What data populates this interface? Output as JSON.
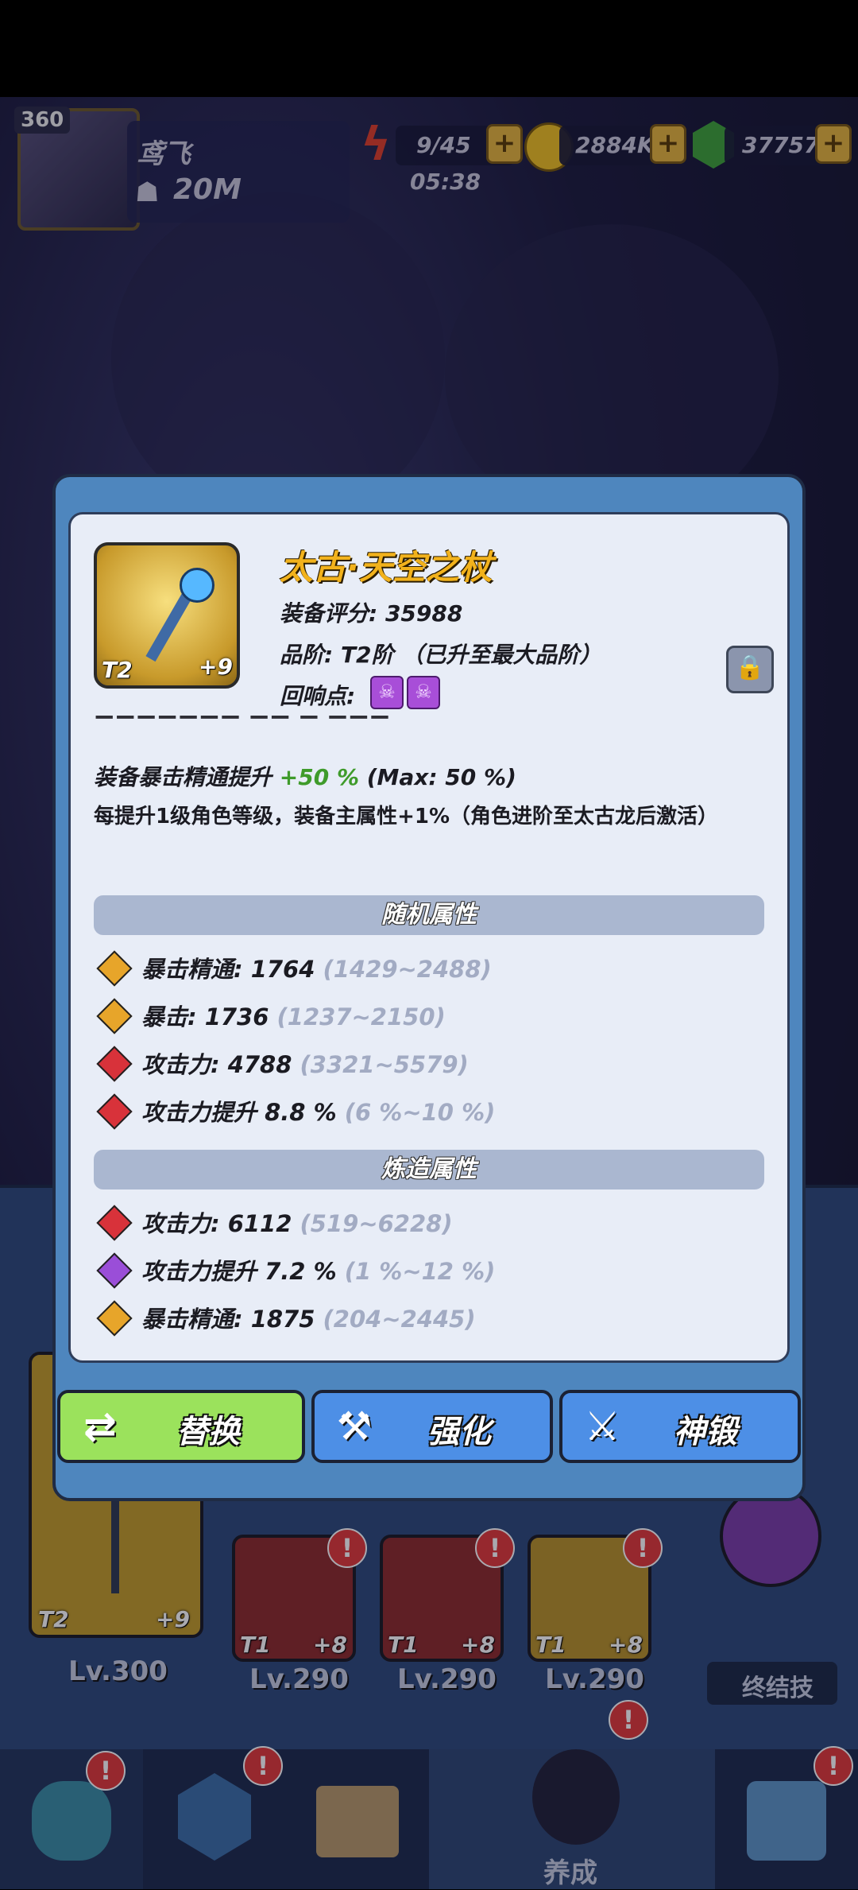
{
  "hud": {
    "level": "360",
    "player_name": "鸢飞",
    "power": "20M",
    "stamina": "9/45",
    "stamina_timer": "05:38",
    "gold": "2884K",
    "gems": "37757",
    "plus": "+"
  },
  "item": {
    "name": "太古·天空之杖",
    "tier_badge": "T2",
    "enhance": "+9",
    "score_label": "装备评分: 35988",
    "grade_label": "品阶: T2阶 （已升至最大品阶）",
    "echo_label": "回响点:",
    "echo_icons": [
      "skull-icon",
      "skull-icon"
    ]
  },
  "details": {
    "crit_mastery_boost_prefix": "装备暴击精通提升",
    "crit_mastery_boost_value": "+50 %",
    "crit_mastery_boost_max": "(Max: 50 %)",
    "level_bonus": "每提升1级角色等级，装备主属性+1%（角色进阶至太古龙后激活）"
  },
  "random_section": {
    "title": "随机属性",
    "attrs": [
      {
        "gem": "gold",
        "label": "暴击精通: 1764",
        "range": "(1429~2488)"
      },
      {
        "gem": "gold",
        "label": "暴击: 1736",
        "range": "(1237~2150)"
      },
      {
        "gem": "red",
        "label": "攻击力: 4788",
        "range": "(3321~5579)"
      },
      {
        "gem": "red",
        "label": "攻击力提升 8.8 %",
        "range": "(6 %~10 %)"
      }
    ]
  },
  "forge_section": {
    "title": "炼造属性",
    "attrs": [
      {
        "gem": "red",
        "label": "攻击力: 6112",
        "range": "(519~6228)"
      },
      {
        "gem": "purple",
        "label": "攻击力提升 7.2 %",
        "range": "(1 %~12 %)"
      },
      {
        "gem": "gold",
        "label": "暴击精通: 1875",
        "range": "(204~2445)"
      }
    ]
  },
  "buttons": {
    "replace": "替换",
    "enhance": "强化",
    "divine_forge": "神锻"
  },
  "colors": {
    "gold": "#e7a52a",
    "red": "#d8323a",
    "purple": "#9a4ed8",
    "green_btn": "#9be25c",
    "blue_btn": "#4d8fe6",
    "boost_green": "#3f9b2b"
  },
  "bottom": {
    "main_card": {
      "tier": "T2",
      "enhance": "+9",
      "level": "Lv.300"
    },
    "cards": [
      {
        "tier": "T1",
        "enhance": "+8",
        "level": "Lv.290"
      },
      {
        "tier": "T1",
        "enhance": "+8",
        "level": "Lv.290"
      },
      {
        "tier": "T1",
        "enhance": "+8",
        "level": "Lv.290"
      }
    ],
    "ultimate_label": "终结技",
    "nav_active_label": "养成",
    "badge": "!"
  }
}
